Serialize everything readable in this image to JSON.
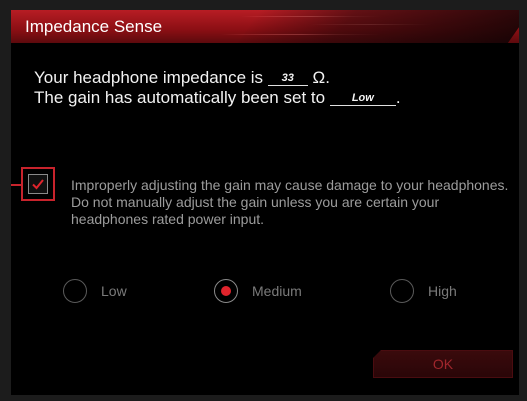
{
  "window": {
    "title": "Impedance Sense"
  },
  "info": {
    "impedance_prefix": "Your headphone impedance is",
    "impedance_value": "33",
    "impedance_unit": "Ω.",
    "gain_prefix": "The gain has automatically been set to",
    "gain_value": "Low",
    "gain_suffix": "."
  },
  "manual_gain": {
    "checked": true,
    "warning_text": "Improperly adjusting the gain may cause damage to your headphones.  Do not manually adjust the gain unless you are certain your headphones rated power input."
  },
  "gain_options": [
    {
      "label": "Low",
      "selected": false
    },
    {
      "label": "Medium",
      "selected": true
    },
    {
      "label": "High",
      "selected": false
    }
  ],
  "ok_button": {
    "label": "OK"
  },
  "colors": {
    "accent": "#c8232c",
    "radio_selected": "#e0242c",
    "title_bar": "#b71d24",
    "background": "#000000"
  }
}
